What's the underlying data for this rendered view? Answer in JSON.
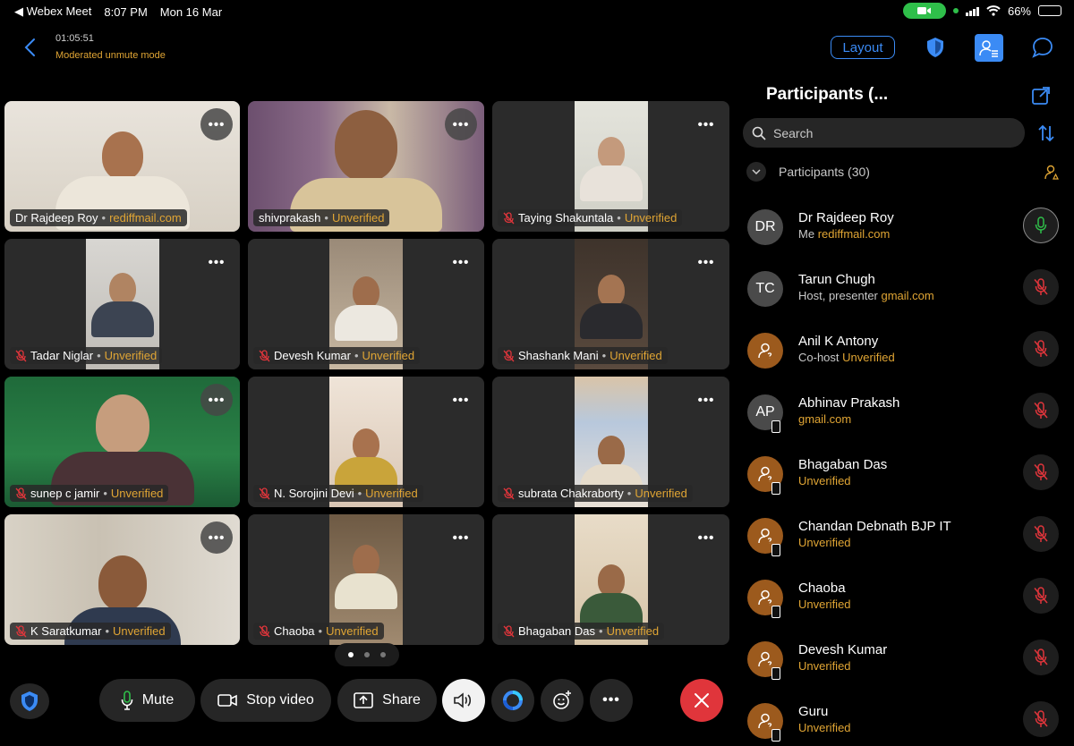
{
  "status_bar": {
    "app_back": "◀ Webex Meet",
    "time": "8:07 PM",
    "date": "Mon 16 Mar",
    "battery": "66%",
    "battery_level": 0.66
  },
  "header": {
    "timer": "01:05:51",
    "mode": "Moderated unmute mode",
    "layout_label": "Layout"
  },
  "tiles": [
    {
      "name": "Dr Rajdeep Roy",
      "sep": "•",
      "status": "rediffmail.com",
      "muted": false
    },
    {
      "name": "shivprakash",
      "sep": "•",
      "status": "Unverified",
      "muted": false
    },
    {
      "name": "Taying Shakuntala",
      "sep": "•",
      "status": "Unverified",
      "muted": true
    },
    {
      "name": "Tadar Niglar",
      "sep": "•",
      "status": "Unverified",
      "muted": true
    },
    {
      "name": "Devesh Kumar",
      "sep": "•",
      "status": "Unverified",
      "muted": true
    },
    {
      "name": "Shashank Mani",
      "sep": "•",
      "status": "Unverified",
      "muted": true
    },
    {
      "name": "sunep c jamir",
      "sep": "•",
      "status": "Unverified",
      "muted": true
    },
    {
      "name": "N. Sorojini Devi",
      "sep": "•",
      "status": "Unverified",
      "muted": true
    },
    {
      "name": "subrata Chakraborty",
      "sep": "•",
      "status": "Unverified",
      "muted": true
    },
    {
      "name": "K Saratkumar",
      "sep": "•",
      "status": "Unverified",
      "muted": true
    },
    {
      "name": "Chaoba",
      "sep": "•",
      "status": "Unverified",
      "muted": true
    },
    {
      "name": "Bhagaban Das",
      "sep": "•",
      "status": "Unverified",
      "muted": true
    }
  ],
  "more_label": "•••",
  "controls": {
    "mute_label": "Mute",
    "stop_video_label": "Stop video",
    "share_label": "Share"
  },
  "panel": {
    "title": "Participants (...",
    "search_placeholder": "Search",
    "group_label": "Participants (30)"
  },
  "participants": [
    {
      "initials": "DR",
      "name": "Dr Rajdeep Roy",
      "role": "Me",
      "detail": "rediffmail.com",
      "avatar": "initials",
      "mobile": false,
      "mic": "on"
    },
    {
      "initials": "TC",
      "name": "Tarun Chugh",
      "role": "Host, presenter",
      "detail": "gmail.com",
      "avatar": "initials",
      "mobile": false,
      "mic": "off"
    },
    {
      "initials": "",
      "name": "Anil K Antony",
      "role": "Co-host",
      "detail": "Unverified",
      "avatar": "guest",
      "mobile": false,
      "mic": "off"
    },
    {
      "initials": "AP",
      "name": "Abhinav Prakash",
      "role": "",
      "detail": "gmail.com",
      "avatar": "initials",
      "mobile": true,
      "mic": "off"
    },
    {
      "initials": "",
      "name": "Bhagaban Das",
      "role": "",
      "detail": "Unverified",
      "avatar": "guest",
      "mobile": true,
      "mic": "off"
    },
    {
      "initials": "",
      "name": "Chandan Debnath BJP IT",
      "role": "",
      "detail": "Unverified",
      "avatar": "guest",
      "mobile": true,
      "mic": "off"
    },
    {
      "initials": "",
      "name": "Chaoba",
      "role": "",
      "detail": "Unverified",
      "avatar": "guest",
      "mobile": true,
      "mic": "off"
    },
    {
      "initials": "",
      "name": "Devesh Kumar",
      "role": "",
      "detail": "Unverified",
      "avatar": "guest",
      "mobile": true,
      "mic": "off"
    },
    {
      "initials": "",
      "name": "Guru",
      "role": "",
      "detail": "Unverified",
      "avatar": "guest",
      "mobile": true,
      "mic": "off"
    }
  ],
  "colors": {
    "accent": "#3b8bf5",
    "warning_text": "#e0a534",
    "end_call": "#e0353b",
    "mic_on": "#2fbf4a",
    "mic_off": "#e0353b"
  }
}
